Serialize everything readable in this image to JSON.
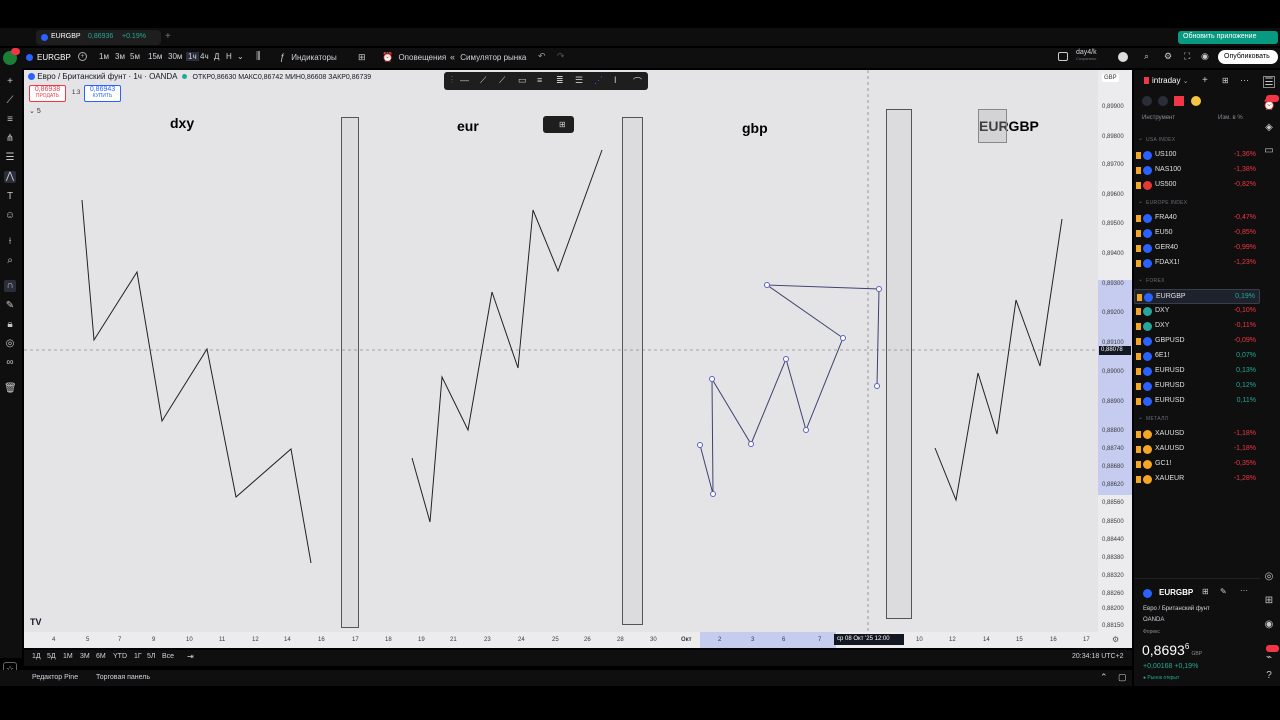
{
  "tabs": {
    "symbol_tab": "EURGBP",
    "tab_price": "0,86936",
    "tab_change": "+0.19%"
  },
  "update_button": "Обновить приложение",
  "toolbar": {
    "symbol": "EURGBP",
    "timeframes": [
      "1м",
      "3м",
      "5м",
      "15м",
      "30м",
      "1ч",
      "4ч",
      "Д",
      "Н"
    ],
    "indicators": "Индикаторы",
    "alerts": "Оповещения",
    "replay": "Симулятор рынка",
    "layout_name": "day4/k",
    "layout_sub": "Сохранено",
    "publish": "Опубликовать"
  },
  "legend": {
    "title": "Евро / Британский фунт · 1ч · OANDA",
    "ohlc": "ОТКР0,86630 МАКС0,86742 МИН0,86608 ЗАКР0,86739",
    "sell_price": "0,86938",
    "sell_label": "ПРОДАТЬ",
    "spread": "1.3",
    "buy_price": "0,86943",
    "buy_label": "КУПИТЬ",
    "indicator_count": "5"
  },
  "chart": {
    "labels": {
      "dxy": "dxy",
      "eur": "eur",
      "gbp": "gbp",
      "eurgbp": "EURGBP"
    },
    "currency": "GBP",
    "price_marker": "0,88078",
    "y_ticks": [
      "0,89900",
      "0,89800",
      "0,89700",
      "0,89600",
      "0,89500",
      "0,89400",
      "0,89300",
      "0,89200",
      "0,89100",
      "0,89000",
      "0,88900",
      "0,88800",
      "0,88740",
      "0,88680",
      "0,88620",
      "0,88560",
      "0,88500",
      "0,88440",
      "0,88380",
      "0,88320",
      "0,88260",
      "0,88200",
      "0,88150"
    ],
    "x_ticks": [
      "4",
      "5",
      "7",
      "9",
      "10",
      "11",
      "12",
      "14",
      "16",
      "17",
      "18",
      "19",
      "21",
      "23",
      "24",
      "25",
      "26",
      "28",
      "30",
      "Окт",
      "2",
      "3",
      "6",
      "7",
      "10",
      "12",
      "14",
      "15",
      "16",
      "17"
    ],
    "crosshair_time": "ср 08 Окт '25  12:00"
  },
  "ranges": [
    "1Д",
    "5Д",
    "1М",
    "3М",
    "6М",
    "YTD",
    "1Г",
    "5Л",
    "Все"
  ],
  "clock": "20:34:18 UTC+2",
  "footer": {
    "pine": "Редактор Pine",
    "panel": "Торговая панель"
  },
  "watchlist": {
    "name": "intraday",
    "col_symbol": "Инструмент",
    "col_change": "Изм. в %",
    "sections": [
      {
        "title": "USA INDEX",
        "rows": [
          {
            "sym": "US100",
            "chg": "-1,36%",
            "color": "#2962ff"
          },
          {
            "sym": "NAS100",
            "chg": "-1,38%",
            "color": "#2962ff"
          },
          {
            "sym": "US500",
            "chg": "-0,82%",
            "color": "#e53935"
          }
        ]
      },
      {
        "title": "EUROPE INDEX",
        "rows": [
          {
            "sym": "FRA40",
            "chg": "-0,47%",
            "color": "#2962ff"
          },
          {
            "sym": "EU50",
            "chg": "-0,85%",
            "color": "#2962ff"
          },
          {
            "sym": "GER40",
            "chg": "-0,99%",
            "color": "#2962ff"
          },
          {
            "sym": "FDAX1!",
            "chg": "-1,23%",
            "color": "#2962ff"
          }
        ]
      },
      {
        "title": "FOREX",
        "rows": [
          {
            "sym": "EURGBP",
            "chg": "0,19%",
            "color": "#2962ff"
          },
          {
            "sym": "DXY",
            "chg": "-0,10%",
            "color": "#26a69a"
          },
          {
            "sym": "DXY",
            "chg": "-0,11%",
            "color": "#26a69a"
          },
          {
            "sym": "GBPUSD",
            "chg": "-0,09%",
            "color": "#2962ff"
          },
          {
            "sym": "6E1!",
            "chg": "0,07%",
            "color": "#2962ff"
          },
          {
            "sym": "EURUSD",
            "chg": "0,13%",
            "color": "#2962ff"
          },
          {
            "sym": "EURUSD",
            "chg": "0,12%",
            "color": "#2962ff"
          },
          {
            "sym": "EURUSD",
            "chg": "0,11%",
            "color": "#2962ff"
          }
        ]
      },
      {
        "title": "МЕТАЛЛ",
        "rows": [
          {
            "sym": "XAUUSD",
            "chg": "-1,18%",
            "color": "#f5a623"
          },
          {
            "sym": "XAUUSD",
            "chg": "-1,18%",
            "color": "#f5a623"
          },
          {
            "sym": "GC1!",
            "chg": "-0,35%",
            "color": "#f5a623"
          },
          {
            "sym": "XAUEUR",
            "chg": "-1,28%",
            "color": "#f5a623"
          }
        ]
      }
    ]
  },
  "details": {
    "symbol": "EURGBP",
    "desc": "Евро / Британский фунт",
    "exchange": "OANDA",
    "type": "Форекс",
    "price_main": "0,8693",
    "price_frac": "6",
    "currency": "GBP",
    "change": "+0,00168",
    "change_pct": "+0,19%",
    "status": "Рынок открыт"
  },
  "colors": {
    "accent": "#2962ff",
    "negative": "#f23645",
    "positive": "#22ab94",
    "update": "#089981"
  }
}
